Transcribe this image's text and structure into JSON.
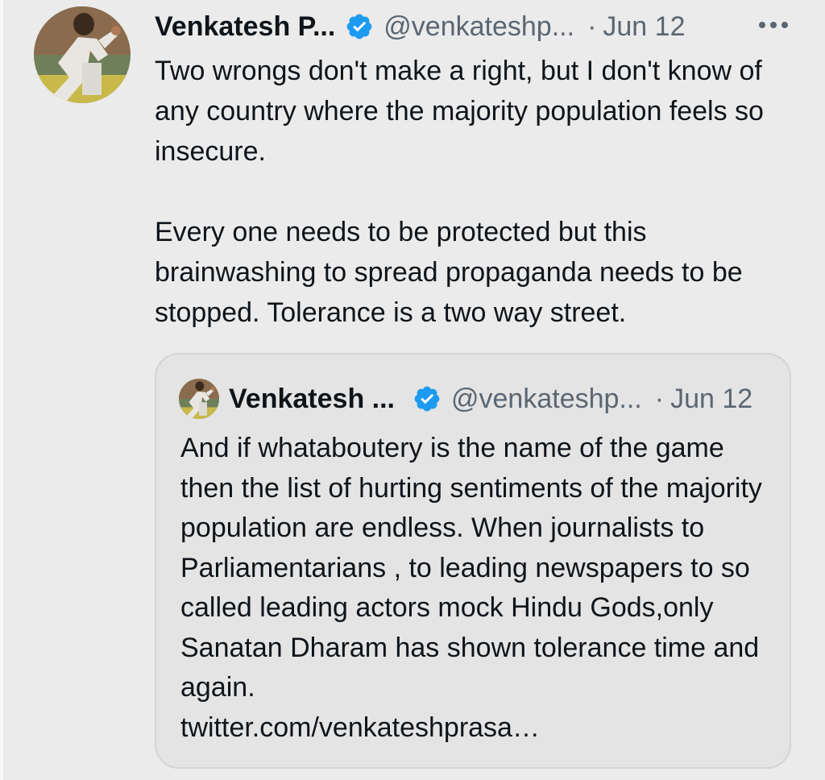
{
  "tweet": {
    "author_name": "Venkatesh P...",
    "handle": "@venkateshp...",
    "separator": "·",
    "date": "Jun 12",
    "text": "Two wrongs don't make a right, but I don't know of any country where the majority population feels so insecure.\n\nEvery one needs to be protected but this brainwashing to spread propaganda needs to be stopped. Tolerance is a two way street."
  },
  "quoted_tweet": {
    "author_name": "Venkatesh ...",
    "handle": "@venkateshp...",
    "separator": "·",
    "date": "Jun 12",
    "text": "And if whataboutery is the name of the game then the list of hurting sentiments of the majority population are endless. When journalists to Parliamentarians , to leading newspapers to so called leading actors mock Hindu Gods,only Sanatan Dharam has shown tolerance time and again.\ntwitter.com/venkateshprasa…"
  },
  "icons": {
    "verified": "verified-badge-icon",
    "more": "more-options-icon"
  },
  "colors": {
    "background": "#ebebeb",
    "verified_blue": "#1d9bf0",
    "secondary_text": "#5b6671",
    "quote_background": "#e4e4e4"
  }
}
